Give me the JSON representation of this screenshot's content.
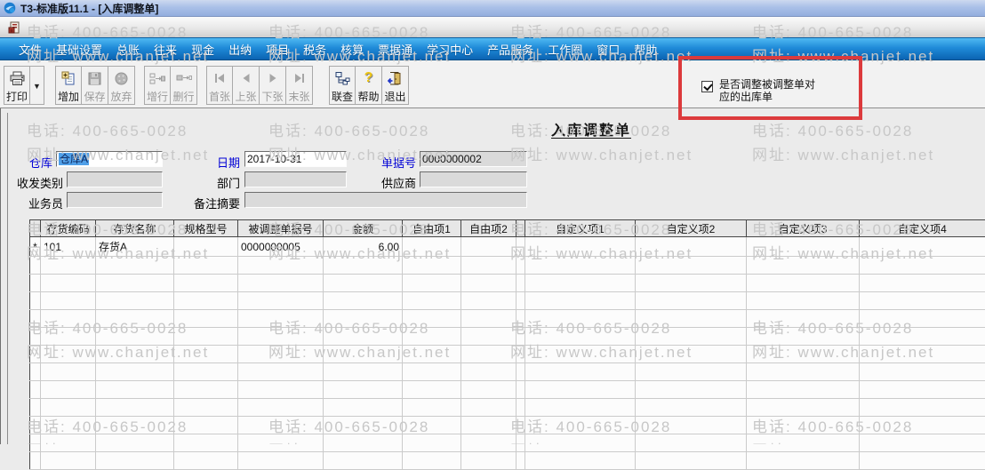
{
  "window": {
    "title": "T3-标准版11.1 - [入库调整单]"
  },
  "watermark": {
    "phone": "电话: 400-665-0028",
    "site": "网址: www.chanjet.net"
  },
  "menu": {
    "items": [
      "文件",
      "基础设置",
      "总账",
      "往来",
      "现金",
      "出纳",
      "项目",
      "税务",
      "核算",
      "票据通",
      "学习中心",
      "产品服务",
      "工作圈",
      "窗口",
      "帮助"
    ]
  },
  "toolbar": {
    "icons": {
      "dropdown": "▼",
      "help": "?"
    },
    "buttons": [
      {
        "label": "打印",
        "enabled": true
      },
      {
        "label": "增加",
        "enabled": true
      },
      {
        "label": "保存",
        "enabled": false
      },
      {
        "label": "放弃",
        "enabled": false
      },
      {
        "label": "增行",
        "enabled": false
      },
      {
        "label": "删行",
        "enabled": false
      },
      {
        "label": "首张",
        "enabled": false
      },
      {
        "label": "上张",
        "enabled": false
      },
      {
        "label": "下张",
        "enabled": false
      },
      {
        "label": "末张",
        "enabled": false
      },
      {
        "label": "联查",
        "enabled": true
      },
      {
        "label": "帮助",
        "enabled": true
      },
      {
        "label": "退出",
        "enabled": true
      }
    ],
    "adjust_checkbox": {
      "label": "是否调整被调整单对应的出库单",
      "checked": true
    }
  },
  "form": {
    "title": "入库调整单",
    "fields": {
      "warehouse": {
        "label": "仓库",
        "value": "仓库A"
      },
      "date": {
        "label": "日期",
        "value": "2017-10-31"
      },
      "doc_no": {
        "label": "单据号",
        "value": "0000000002"
      },
      "inout_type": {
        "label": "收发类别",
        "value": ""
      },
      "department": {
        "label": "部门",
        "value": ""
      },
      "supplier": {
        "label": "供应商",
        "value": ""
      },
      "salesman": {
        "label": "业务员",
        "value": ""
      },
      "memo": {
        "label": "备注摘要",
        "value": ""
      }
    }
  },
  "grid": {
    "columns": [
      "存货编码",
      "存货名称",
      "规格型号",
      "被调整单据号",
      "金额",
      "自由项1",
      "自由项2",
      "自定义项1",
      "自定义项2",
      "自定义项3",
      "自定义项4"
    ],
    "rows": [
      {
        "marker": "*",
        "code": "101",
        "name": "存货A",
        "spec": "",
        "adjusted_doc_no": "0000000005",
        "amount": "6.00",
        "free1": "",
        "free2": "",
        "custom1": "",
        "custom2": "",
        "custom3": "",
        "custom4": ""
      }
    ]
  },
  "colors": {
    "annotation_red": "#dc3a3c",
    "menu_blue": "#1f8ad8",
    "selection_blue": "#4f9fe8",
    "required_label_blue": "#0000d6"
  }
}
